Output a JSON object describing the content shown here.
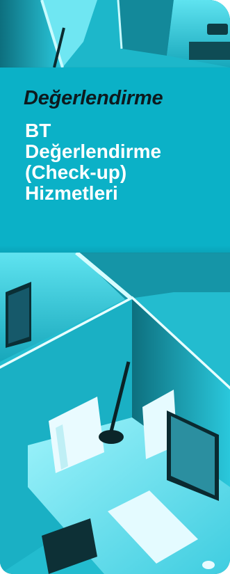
{
  "banner": {
    "category": "Değerlendirme",
    "title_lines": [
      "BT",
      "Değerlendirme",
      "(Check-up)",
      "Hizmetleri"
    ]
  },
  "image": {
    "description_icon": "office-cubicles-illustration",
    "accent_color": "#0bb1c7",
    "text_color": "#ffffff",
    "category_color": "#0d1a1e"
  }
}
